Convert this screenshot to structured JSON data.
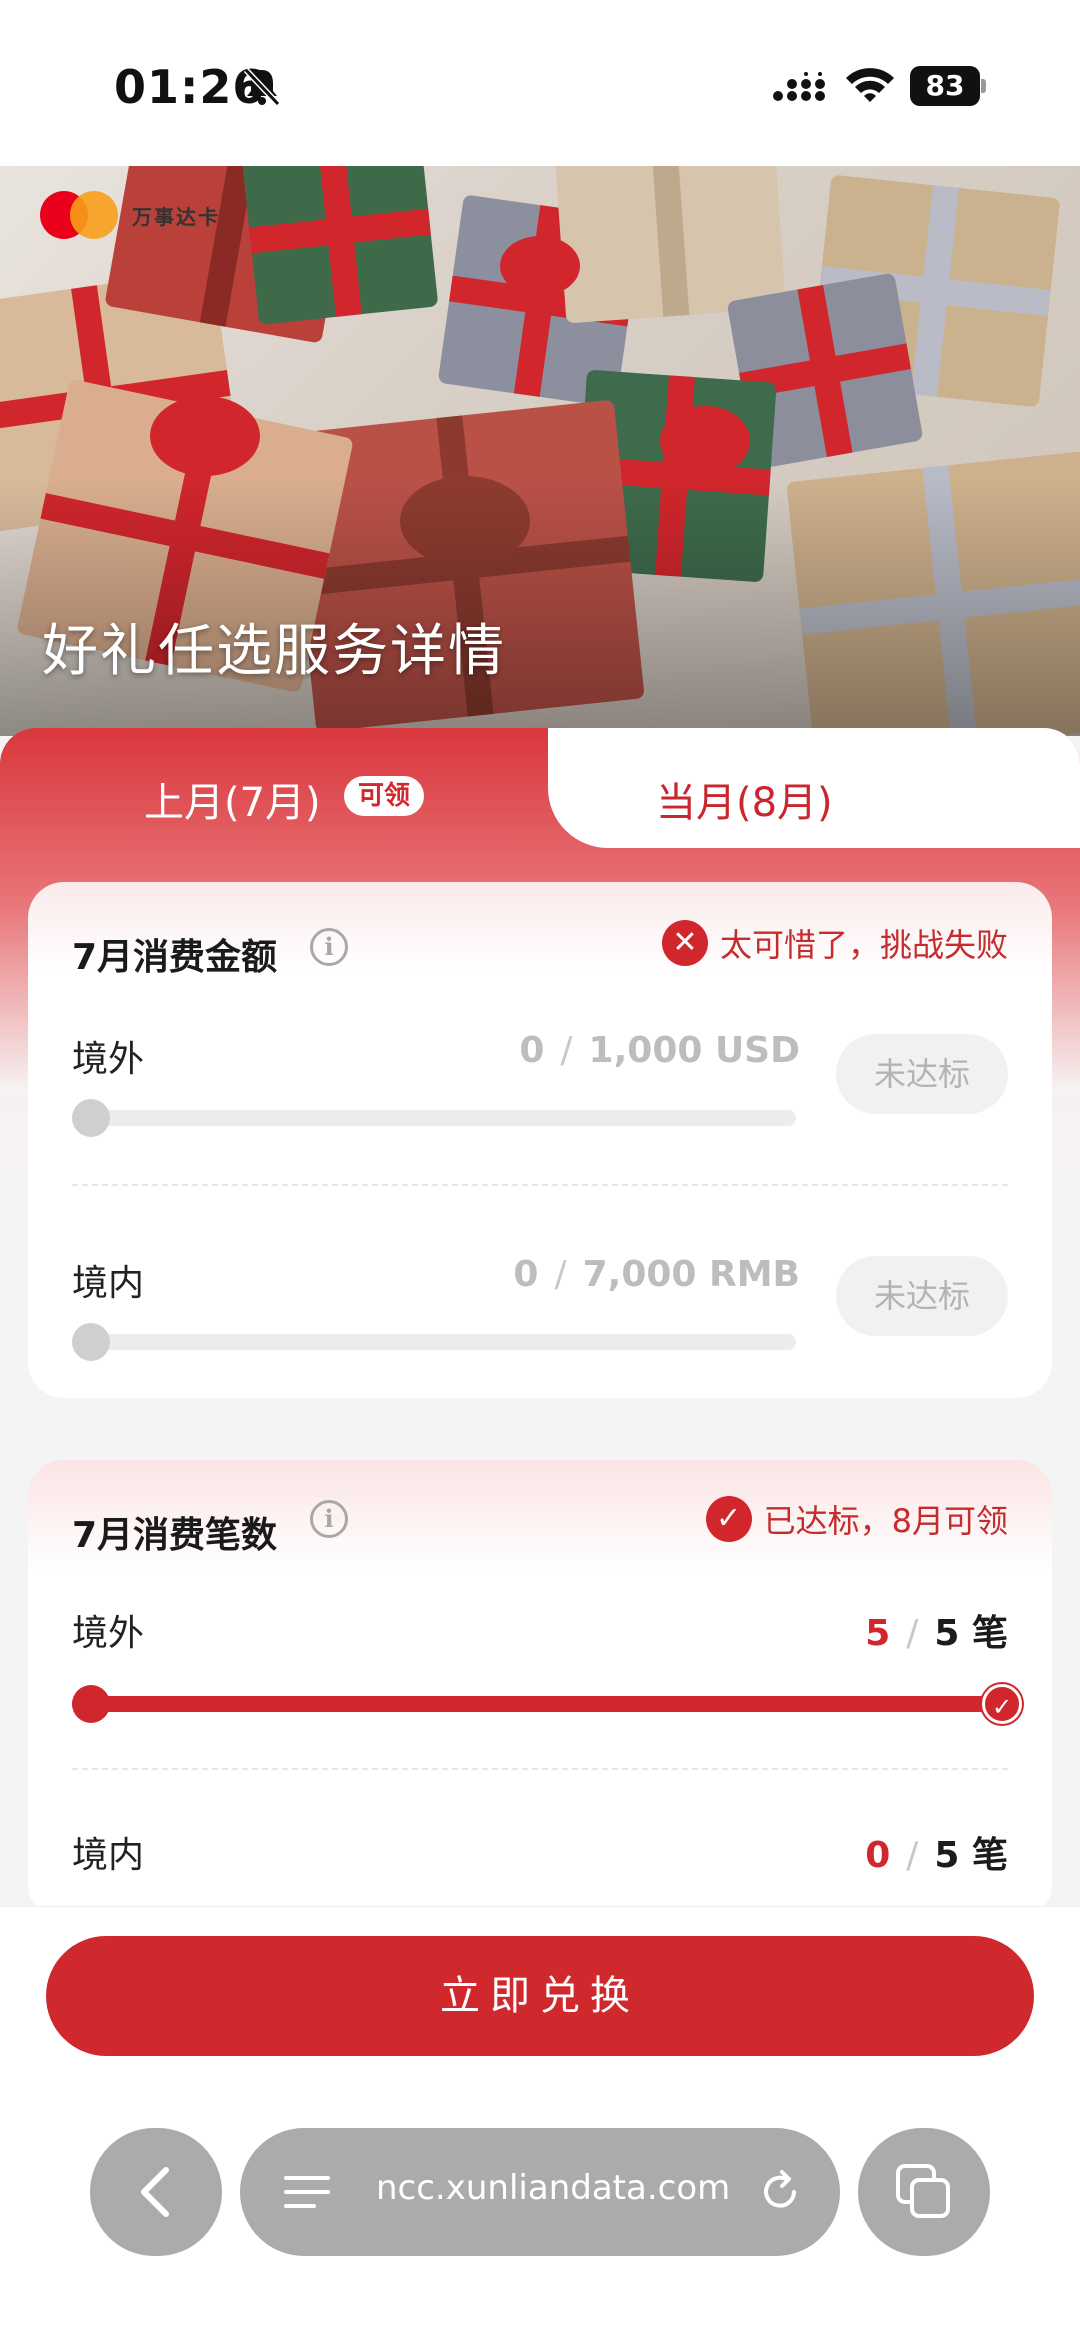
{
  "status_bar": {
    "time": "01:26",
    "battery": "83"
  },
  "hero": {
    "brand": "万事达卡",
    "title": "好礼任选服务详情"
  },
  "tabs": [
    {
      "label": "上月(7月)",
      "badge": "可领",
      "active": true
    },
    {
      "label": "当月(8月)",
      "active": false
    }
  ],
  "amount_card": {
    "title": "7月消费金额",
    "status": "太可惜了，挑战失败",
    "rows": [
      {
        "label": "境外",
        "current": "0",
        "target": "1,000 USD",
        "action": "未达标",
        "progress": 0
      },
      {
        "label": "境内",
        "current": "0",
        "target": "7,000 RMB",
        "action": "未达标",
        "progress": 0
      }
    ]
  },
  "count_card": {
    "title": "7月消费笔数",
    "status": "已达标，8月可领",
    "rows": [
      {
        "label": "境外",
        "current": "5",
        "target": "5 笔",
        "progress": 1.0
      },
      {
        "label": "境内",
        "current": "0",
        "target": "5 笔",
        "progress": 0
      }
    ]
  },
  "cta": {
    "label": "立即兑换"
  },
  "browser": {
    "url": "ncc.xunliandata.com"
  },
  "colors": {
    "accent": "#d0262c",
    "muted": "#bdbdbd"
  }
}
